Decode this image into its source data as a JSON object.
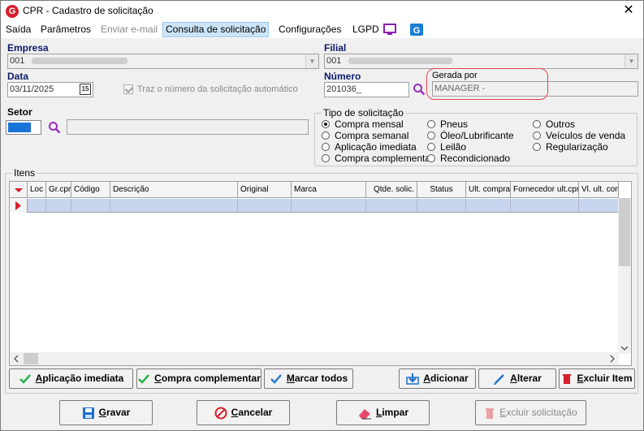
{
  "window": {
    "title": "CPR - Cadastro de solicitação",
    "close_glyph": "✕"
  },
  "menu": {
    "items": [
      {
        "label": "Saída",
        "state": "normal"
      },
      {
        "label": "Parâmetros",
        "state": "normal"
      },
      {
        "label": "Enviar e-mail",
        "state": "disabled"
      },
      {
        "label": "Consulta de solicitação",
        "state": "active"
      },
      {
        "label": "Configurações",
        "state": "normal"
      },
      {
        "label": "LGPD",
        "state": "normal"
      }
    ],
    "icons": [
      "monitor-icon",
      "app-logo-icon"
    ]
  },
  "form": {
    "empresa": {
      "label": "Empresa",
      "value": "001"
    },
    "filial": {
      "label": "Filial",
      "value": "001"
    },
    "data": {
      "label": "Data",
      "value": "03/11/2025",
      "calendar_glyph": "15"
    },
    "auto_number": {
      "label": "Traz o número da solicitação automático",
      "checked": true
    },
    "numero": {
      "label": "Número",
      "value": "201036_"
    },
    "gerada_por": {
      "label": "Gerada por",
      "value": "MANAGER -"
    },
    "setor": {
      "label": "Setor"
    }
  },
  "tipo": {
    "title": "Tipo de solicitação",
    "options": [
      {
        "label": "Compra mensal",
        "selected": true
      },
      {
        "label": "Compra semanal",
        "selected": false
      },
      {
        "label": "Aplicação imediata",
        "selected": false
      },
      {
        "label": "Compra complementar",
        "selected": false
      },
      {
        "label": "Pneus",
        "selected": false
      },
      {
        "label": "Óleo/Lubrificante",
        "selected": false
      },
      {
        "label": "Leilão",
        "selected": false
      },
      {
        "label": "Recondicionado",
        "selected": false
      },
      {
        "label": "Outros",
        "selected": false
      },
      {
        "label": "Veículos de venda",
        "selected": false
      },
      {
        "label": "Regularização",
        "selected": false
      }
    ]
  },
  "itens": {
    "title": "Itens",
    "columns": [
      "Loc",
      "Gr.cpr",
      "Código",
      "Descrição",
      "Original",
      "Marca",
      "Qtde. solic.",
      "Status",
      "Ult. compra",
      "Fornecedor ult.cpr",
      "Vl. ult. com"
    ]
  },
  "grid_buttons": {
    "aplicacao": {
      "pre": "",
      "u": "A",
      "post": "plicação imediata"
    },
    "complementar": {
      "pre": "",
      "u": "C",
      "post": "ompra complementar"
    },
    "marcar": {
      "pre": "",
      "u": "M",
      "post": "arcar todos"
    },
    "adicionar": {
      "pre": "",
      "u": "A",
      "post": "dicionar"
    },
    "alterar": {
      "pre": "",
      "u": "A",
      "post": "lterar"
    },
    "excluir_item": {
      "pre": "",
      "u": "E",
      "post": "xcluir Item"
    }
  },
  "footer_buttons": {
    "gravar": {
      "pre": "",
      "u": "G",
      "post": "ravar"
    },
    "cancelar": {
      "pre": "",
      "u": "C",
      "post": "ancelar"
    },
    "limpar": {
      "pre": "",
      "u": "L",
      "post": "impar"
    },
    "excluir_solicitacao": {
      "pre": "",
      "u": "E",
      "post": "xcluir solicitação"
    }
  },
  "colors": {
    "accent_red": "#d81e2a",
    "selection_blue": "#c7d5ef",
    "label_navy": "#0b1a6b",
    "highlight": "#e2474b"
  }
}
